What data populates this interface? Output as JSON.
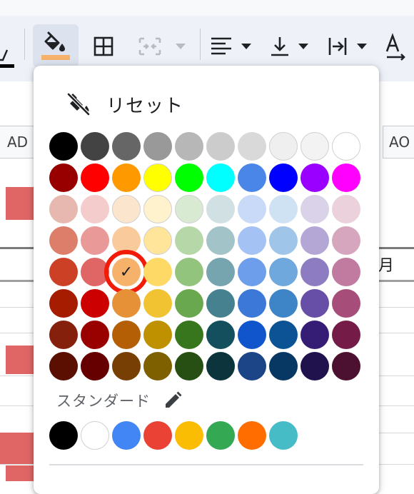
{
  "colors": {
    "toolbar_bg": "#eef2f8",
    "accent_fill": "#f6b26b",
    "selection_ring": "#f11b08",
    "highlight_cell": "#e06666"
  },
  "toolbar": {
    "buttons": [
      {
        "name": "text-color-button",
        "icon": "text-color-icon"
      },
      {
        "name": "fill-color-button",
        "icon": "paint-bucket-icon",
        "active": true
      },
      {
        "name": "borders-button",
        "icon": "borders-icon"
      },
      {
        "name": "merge-cells-button",
        "icon": "merge-icon",
        "disabled": true
      },
      {
        "name": "horizontal-align-button",
        "icon": "align-left-icon"
      },
      {
        "name": "vertical-align-button",
        "icon": "align-bottom-icon"
      },
      {
        "name": "text-wrap-button",
        "icon": "wrap-icon"
      },
      {
        "name": "text-rotation-button",
        "icon": "text-rotate-icon"
      }
    ]
  },
  "sheet": {
    "column_headers": [
      "AD",
      "AO"
    ],
    "month_label": "月"
  },
  "popup": {
    "reset_label": "リセット",
    "standard_label": "スタンダード",
    "palette": [
      [
        "#000000",
        "#434343",
        "#666666",
        "#999999",
        "#b7b7b7",
        "#cccccc",
        "#d9d9d9",
        "#efefef",
        "#f3f3f3",
        "#ffffff"
      ],
      [
        "#980000",
        "#ff0000",
        "#ff9900",
        "#ffff00",
        "#00ff00",
        "#00ffff",
        "#4a86e8",
        "#0000ff",
        "#9900ff",
        "#ff00ff"
      ],
      [
        "#e6b8af",
        "#f4cccc",
        "#fce5cd",
        "#fff2cc",
        "#d9ead3",
        "#d0e0e3",
        "#c9daf8",
        "#cfe2f3",
        "#d9d2e9",
        "#ead1dc"
      ],
      [
        "#dd7e6b",
        "#ea9999",
        "#f9cb9c",
        "#ffe599",
        "#b6d7a8",
        "#a2c4c9",
        "#a4c2f4",
        "#9fc5e8",
        "#b4a7d6",
        "#d5a6bd"
      ],
      [
        "#cc4125",
        "#e06666",
        "#f6b26b",
        "#ffd966",
        "#93c47d",
        "#76a5af",
        "#6d9eeb",
        "#6fa8dc",
        "#8e7cc3",
        "#c27ba0"
      ],
      [
        "#a61c00",
        "#cc0000",
        "#e69138",
        "#f1c232",
        "#6aa84f",
        "#45818e",
        "#3c78d8",
        "#3d85c6",
        "#674ea7",
        "#a64d79"
      ],
      [
        "#85200c",
        "#990000",
        "#b45f06",
        "#bf9000",
        "#38761d",
        "#134f5c",
        "#1155cc",
        "#0b5394",
        "#351c75",
        "#741b47"
      ],
      [
        "#5b0f00",
        "#660000",
        "#783f04",
        "#7f6000",
        "#274e13",
        "#0c343d",
        "#1c4587",
        "#073763",
        "#20124d",
        "#4c1130"
      ]
    ],
    "selected": {
      "row": 4,
      "col": 2,
      "check_glyph": "✓"
    },
    "standard_colors": [
      "#000000",
      "#ffffff",
      "#4285f4",
      "#ea4335",
      "#fbbc04",
      "#34a853",
      "#ff6d01",
      "#46bdc6"
    ]
  }
}
